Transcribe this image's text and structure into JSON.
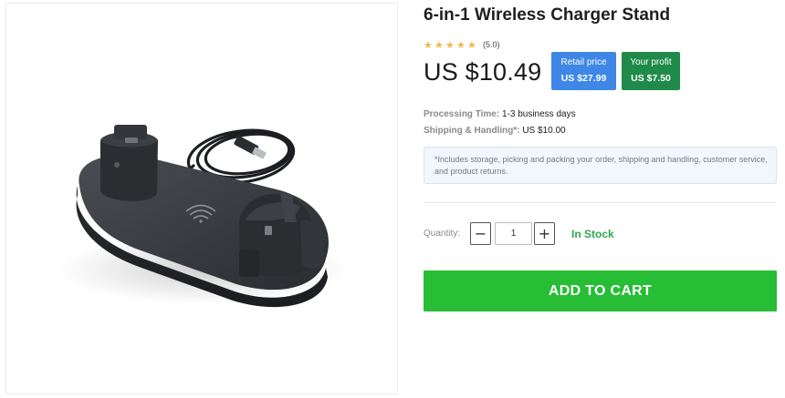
{
  "product": {
    "title": "6-in-1 Wireless Charger Stand",
    "image_alt": "Black wireless charging dock with cable",
    "rating": {
      "stars": 5,
      "value_text": "(5.0)",
      "star_glyph": "★",
      "star_color": "#f5b54a"
    },
    "price": "US $10.49",
    "retail": {
      "label": "Retail price",
      "value": "US $27.99",
      "color": "#3f87e6"
    },
    "profit": {
      "label": "Your profit",
      "value": "US $7.50",
      "color": "#1f8a4a"
    },
    "processing": {
      "label": "Processing Time:",
      "value": "1-3 business days"
    },
    "shipping": {
      "label": "Shipping & Handling*:",
      "value": "US $10.00"
    },
    "note": "*Includes storage, picking and packing your order, shipping and handling, customer service, and product returns.",
    "quantity": {
      "label": "Quantity:",
      "value": "1",
      "minus_symbol": "−",
      "plus_symbol": "+"
    },
    "stock_status": "In Stock",
    "stock_color": "#2fa84f",
    "cart_button": "ADD TO CART",
    "cart_color": "#27bd35"
  }
}
